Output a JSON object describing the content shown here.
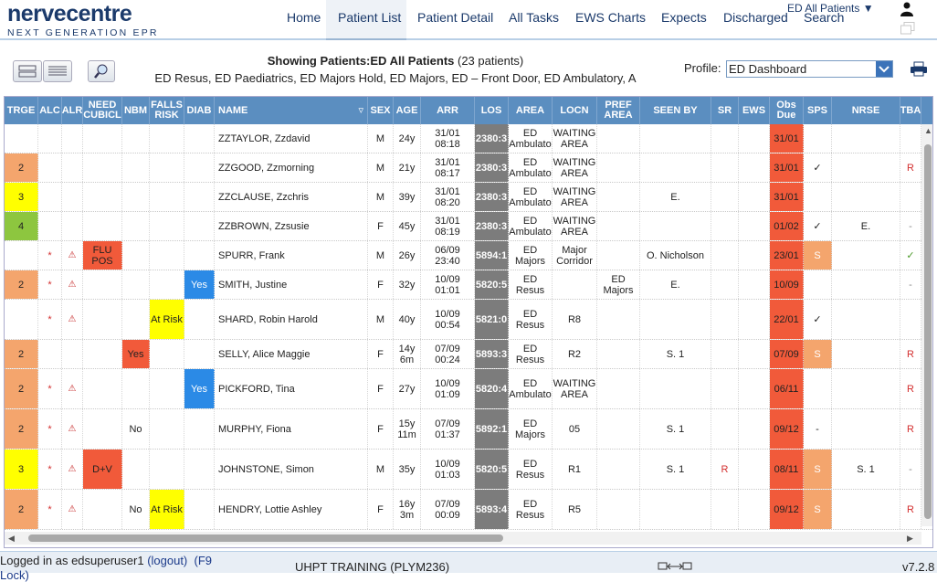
{
  "app": {
    "logo_main": "nervecentre",
    "logo_sub": "NEXT GENERATION EPR"
  },
  "nav": {
    "items": [
      {
        "label": "Home"
      },
      {
        "label": "Patient List"
      },
      {
        "label": "Patient Detail"
      },
      {
        "label": "All Tasks"
      },
      {
        "label": "EWS Charts"
      },
      {
        "label": "Expects"
      },
      {
        "label": "Discharged"
      },
      {
        "label": "Search"
      }
    ],
    "active": "Patient List",
    "list_select": "ED All Patients ▼"
  },
  "toolbar": {
    "showing_label": "Showing Patients:ED All Patients",
    "patient_count": "(23 patients)",
    "areas": "ED Resus, ED Paediatrics, ED Majors Hold, ED Majors, ED – Front Door, ED Ambulatory, A",
    "profile_label": "Profile:",
    "profile_value": "ED Dashboard"
  },
  "table": {
    "headers": [
      "TRGE",
      "ALC",
      "ALR",
      "NEED CUBICL",
      "NBM",
      "FALLS RISK",
      "DIAB",
      "NAME",
      "SEX",
      "AGE",
      "ARR",
      "LOS",
      "AREA",
      "LOCN",
      "PREF AREA",
      "SEEN BY",
      "SR",
      "EWS",
      "Obs Due",
      "SPS",
      "NRSE",
      "TBA"
    ],
    "rows": [
      {
        "trge": "",
        "alc": "",
        "alr": "",
        "cubicle": "",
        "nbm": "",
        "falls": "",
        "diab": "",
        "name": "ZZTAYLOR, Zzdavid",
        "sex": "M",
        "age": "24y",
        "arr": "31/01 08:18",
        "los": "2380:3",
        "area": "ED Ambulato",
        "locn": "WAITING AREA",
        "pref": "",
        "seen": "",
        "sr": "",
        "ews": "",
        "obs": "31/01",
        "sps": "",
        "nrse": "",
        "tba": ""
      },
      {
        "trge": "2",
        "alc": "",
        "alr": "",
        "cubicle": "",
        "nbm": "",
        "falls": "",
        "diab": "",
        "name": "ZZGOOD, Zzmorning",
        "sex": "M",
        "age": "21y",
        "arr": "31/01 08:17",
        "los": "2380:3",
        "area": "ED Ambulato",
        "locn": "WAITING AREA",
        "pref": "",
        "seen": "",
        "sr": "",
        "ews": "",
        "obs": "31/01",
        "sps": "✓",
        "nrse": "",
        "tba": "R"
      },
      {
        "trge": "3",
        "alc": "",
        "alr": "",
        "cubicle": "",
        "nbm": "",
        "falls": "",
        "diab": "",
        "name": "ZZCLAUSE, Zzchris",
        "sex": "M",
        "age": "39y",
        "arr": "31/01 08:20",
        "los": "2380:3",
        "area": "ED Ambulato",
        "locn": "WAITING AREA",
        "pref": "",
        "seen": "E.",
        "sr": "",
        "ews": "",
        "obs": "31/01",
        "sps": "",
        "nrse": "",
        "tba": ""
      },
      {
        "trge": "4",
        "alc": "",
        "alr": "",
        "cubicle": "",
        "nbm": "",
        "falls": "",
        "diab": "",
        "name": "ZZBROWN, Zzsusie",
        "sex": "F",
        "age": "45y",
        "arr": "31/01 08:19",
        "los": "2380:3",
        "area": "ED Ambulato",
        "locn": "WAITING AREA",
        "pref": "",
        "seen": "",
        "sr": "",
        "ews": "",
        "obs": "01/02",
        "sps": "✓",
        "nrse": "E.",
        "tba": "-"
      },
      {
        "trge": "",
        "alc": "*",
        "alr": "⚠",
        "cubicle": "FLU POS",
        "nbm": "",
        "falls": "",
        "diab": "",
        "name": "SPURR, Frank",
        "sex": "M",
        "age": "26y",
        "arr": "06/09 23:40",
        "los": "5894:1",
        "area": "ED Majors",
        "locn": "Major Corridor",
        "pref": "",
        "seen": "O. Nicholson",
        "sr": "",
        "ews": "",
        "obs": "23/01",
        "sps": "S",
        "nrse": "",
        "tba": "✓"
      },
      {
        "trge": "2",
        "alc": "*",
        "alr": "⚠",
        "cubicle": "",
        "nbm": "",
        "falls": "",
        "diab": "Yes",
        "name": "SMITH, Justine",
        "sex": "F",
        "age": "32y",
        "arr": "10/09 01:01",
        "los": "5820:5",
        "area": "ED Resus",
        "locn": "",
        "pref": "ED Majors",
        "seen": "E.",
        "sr": "",
        "ews": "",
        "obs": "10/09",
        "sps": "",
        "nrse": "",
        "tba": "-"
      },
      {
        "trge": "",
        "alc": "*",
        "alr": "⚠",
        "cubicle": "",
        "nbm": "",
        "falls": "At Risk",
        "diab": "",
        "name": "SHARD, Robin Harold",
        "sex": "M",
        "age": "40y",
        "arr": "10/09 00:54",
        "los": "5821:0",
        "area": "ED Resus",
        "locn": "R8",
        "pref": "",
        "seen": "",
        "sr": "",
        "ews": "",
        "obs": "22/01",
        "sps": "✓",
        "nrse": "",
        "tba": ""
      },
      {
        "trge": "2",
        "alc": "",
        "alr": "",
        "cubicle": "",
        "nbm": "Yes",
        "falls": "",
        "diab": "",
        "name": "SELLY, Alice Maggie",
        "sex": "F",
        "age": "14y 6m",
        "arr": "07/09 00:24",
        "los": "5893:3",
        "area": "ED Resus",
        "locn": "R2",
        "pref": "",
        "seen": "S. 1",
        "sr": "",
        "ews": "",
        "obs": "07/09",
        "sps": "S",
        "nrse": "",
        "tba": "R"
      },
      {
        "trge": "2",
        "alc": "*",
        "alr": "⚠",
        "cubicle": "",
        "nbm": "",
        "falls": "",
        "diab": "Yes",
        "name": "PICKFORD, Tina",
        "sex": "F",
        "age": "27y",
        "arr": "10/09 01:09",
        "los": "5820:4",
        "area": "ED Ambulato",
        "locn": "WAITING AREA",
        "pref": "",
        "seen": "",
        "sr": "",
        "ews": "",
        "obs": "06/11",
        "sps": "",
        "nrse": "",
        "tba": "R"
      },
      {
        "trge": "2",
        "alc": "*",
        "alr": "⚠",
        "cubicle": "",
        "nbm": "No",
        "falls": "",
        "diab": "",
        "name": "MURPHY, Fiona",
        "sex": "F",
        "age": "15y 11m",
        "arr": "07/09 01:37",
        "los": "5892:1",
        "area": "ED Majors",
        "locn": "05",
        "pref": "",
        "seen": "S. 1",
        "sr": "",
        "ews": "",
        "obs": "09/12",
        "sps": "-",
        "nrse": "",
        "tba": "R"
      },
      {
        "trge": "3",
        "alc": "*",
        "alr": "⚠",
        "cubicle": "D+V",
        "nbm": "",
        "falls": "",
        "diab": "",
        "name": "JOHNSTONE, Simon",
        "sex": "M",
        "age": "35y",
        "arr": "10/09 01:03",
        "los": "5820:5",
        "area": "ED Resus",
        "locn": "R1",
        "pref": "",
        "seen": "S. 1",
        "sr": "R",
        "ews": "",
        "obs": "08/11",
        "sps": "S",
        "nrse": "S. 1",
        "tba": "-"
      },
      {
        "trge": "2",
        "alc": "*",
        "alr": "⚠",
        "cubicle": "",
        "nbm": "No",
        "falls": "At Risk",
        "diab": "",
        "name": "HENDRY, Lottie Ashley",
        "sex": "F",
        "age": "16y 3m",
        "arr": "07/09 00:09",
        "los": "5893:4",
        "area": "ED Resus",
        "locn": "R5",
        "pref": "",
        "seen": "",
        "sr": "",
        "ews": "",
        "obs": "09/12",
        "sps": "S",
        "nrse": "",
        "tba": "R"
      }
    ]
  },
  "colors": {
    "header_blue": "#5b8ec0",
    "triage_2": "#f4a56d",
    "triage_3": "#ffff00",
    "triage_4": "#8dc63f",
    "flag_red": "#f15a3a",
    "diab_blue": "#2b8ae6",
    "falls_yellow": "#ffff00",
    "sps_orange": "#f4a56d",
    "los_grey": "#7c7c7c"
  },
  "footer": {
    "logged_prefix": "Logged in as edsuperuser1",
    "logout": "(logout)",
    "f9": "(F9",
    "lock": "Lock)",
    "site": "UHPT TRAINING (PLYM236)",
    "version": "v7.2.8"
  }
}
